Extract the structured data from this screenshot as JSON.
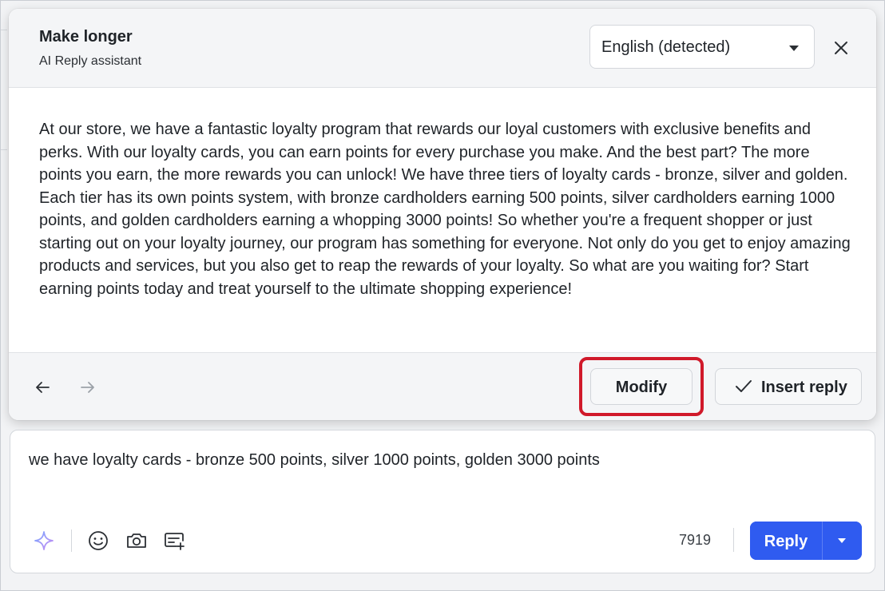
{
  "popup": {
    "title": "Make longer",
    "subtitle": "AI Reply assistant",
    "language": {
      "selected": "English (detected)"
    },
    "icons": {
      "close": "close-icon",
      "back": "arrow-left-icon",
      "forward": "arrow-right-icon"
    },
    "generated_text": "At our store, we have a fantastic loyalty program that rewards our loyal customers with exclusive benefits and perks. With our loyalty cards, you can earn points for every purchase you make. And the best part? The more points you earn, the more rewards you can unlock! We have three tiers of loyalty cards - bronze, silver and golden. Each tier has its own points system, with bronze cardholders earning 500 points, silver cardholders earning 1000 points, and golden cardholders earning a whopping 3000 points! So whether you're a frequent shopper or just starting out on your loyalty journey, our program has something for everyone. Not only do you get to enjoy amazing products and services, but you also get to reap the rewards of your loyalty. So what are you waiting for? Start earning points today and treat yourself to the ultimate shopping experience!",
    "buttons": {
      "modify": "Modify",
      "insert_reply": "Insert reply"
    },
    "highlight_color": "#d0192a"
  },
  "composer": {
    "text": "we have loyalty cards - bronze 500 points, silver 1000 points, golden 3000 points",
    "char_count": "7919",
    "reply_label": "Reply",
    "tools": [
      "sparkle-ai-icon",
      "emoji-icon",
      "camera-icon",
      "template-add-icon"
    ],
    "accent_color": "#2f5bf0"
  }
}
